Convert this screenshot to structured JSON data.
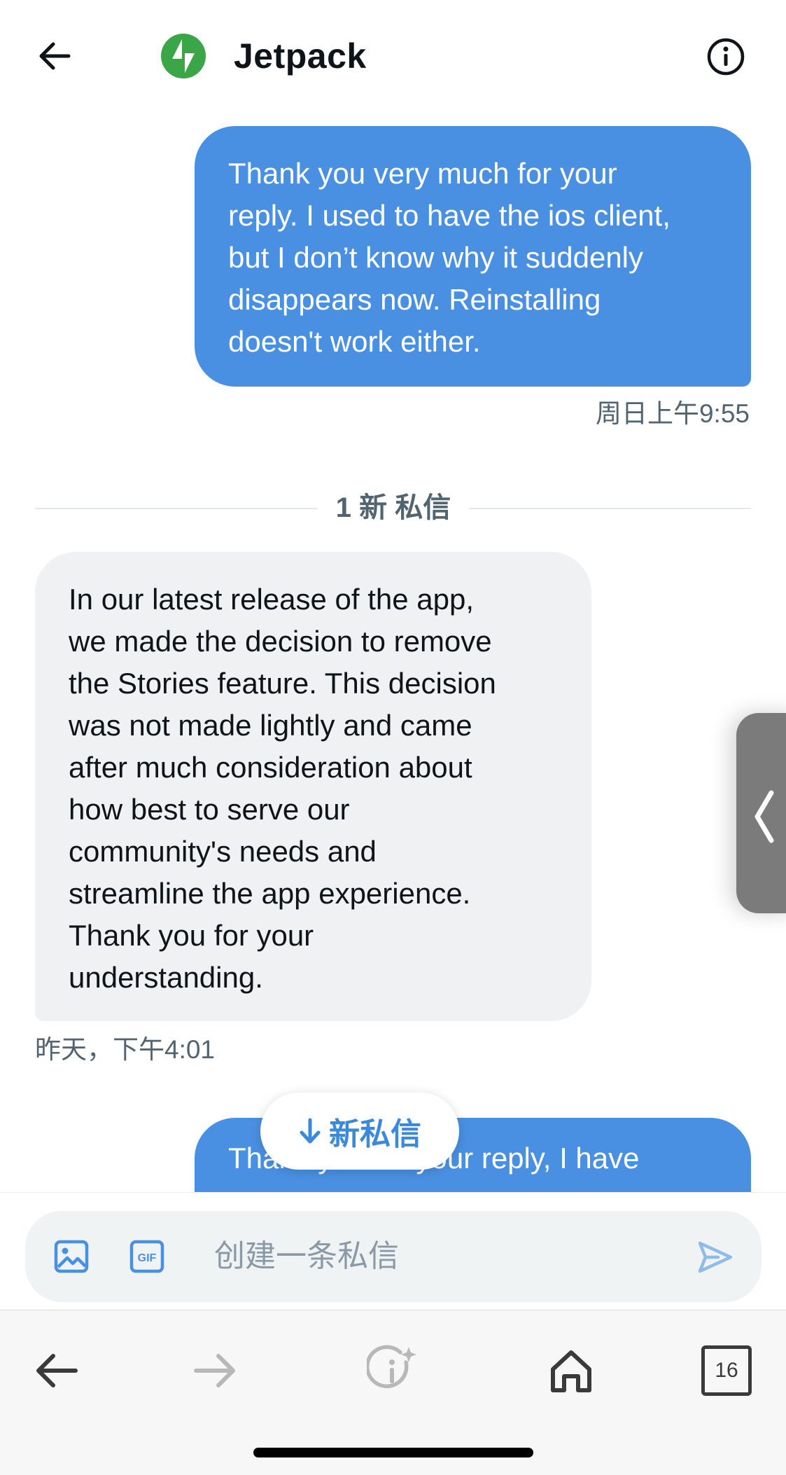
{
  "header": {
    "title": "Jetpack",
    "accent": "#3aa648"
  },
  "messages": [
    {
      "direction": "outgoing",
      "lines": [
        "Thank you very much for your",
        "reply. I used to have the ios client,",
        "but I don’t know why it suddenly",
        "disappears now. Reinstalling",
        "doesn't work either."
      ],
      "timestamp": "周日上午9:55"
    },
    {
      "direction": "incoming",
      "lines": [
        "In our latest release of the app,",
        "we made the decision to remove",
        "the Stories feature. This decision",
        "was not made lightly and came",
        "after much consideration about",
        "how best to serve our",
        "community's needs and",
        "streamline the app experience.",
        "Thank you for your",
        "understanding."
      ],
      "timestamp": "昨天，下午4:01"
    },
    {
      "direction": "outgoing",
      "lines": [
        "Thank you for your reply, I have"
      ]
    }
  ],
  "divider_label": "1 新 私信",
  "new_messages_pill": "新私信",
  "composer": {
    "placeholder": "创建一条私信"
  },
  "browser": {
    "tab_count": "16"
  },
  "colors": {
    "bubble_outgoing": "#4a90e2",
    "bubble_incoming": "#eff1f3",
    "link_blue": "#3b8ad9"
  }
}
